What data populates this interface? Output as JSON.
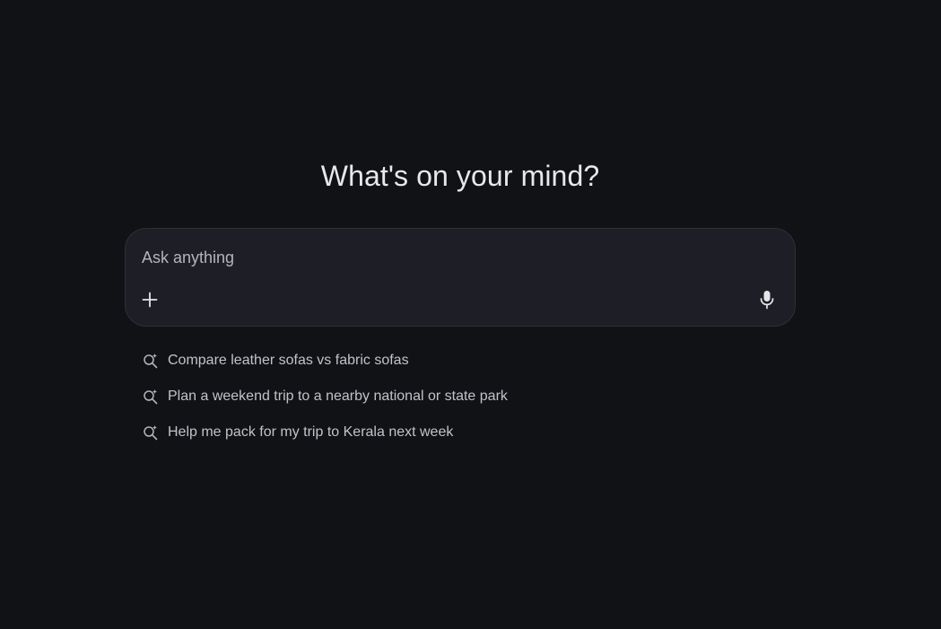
{
  "main": {
    "headline": "What's on your mind?",
    "composer": {
      "placeholder": "Ask anything",
      "value": "",
      "add_icon": "plus-icon",
      "mic_icon": "microphone-icon"
    },
    "suggestions": [
      {
        "icon": "sparkle-search-icon",
        "label": "Compare leather sofas vs fabric sofas"
      },
      {
        "icon": "sparkle-search-icon",
        "label": "Plan a weekend trip to a nearby national or state park"
      },
      {
        "icon": "sparkle-search-icon",
        "label": "Help me pack for my trip to Kerala next week"
      }
    ]
  },
  "colors": {
    "background": "#111216",
    "composer_background": "#1e1f26",
    "composer_border": "#2e2f37",
    "text_primary": "#e8e8ec",
    "text_secondary": "#c2c3c9"
  }
}
